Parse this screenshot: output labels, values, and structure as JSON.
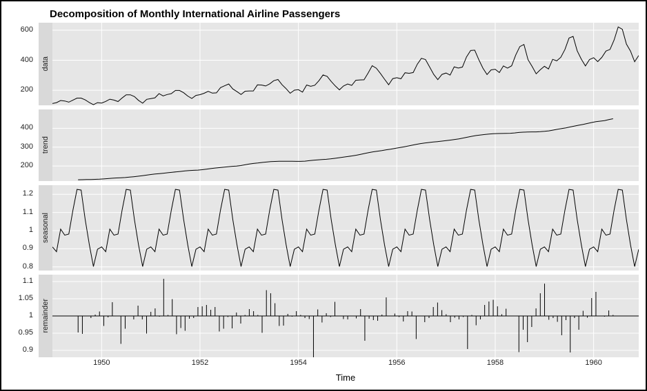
{
  "chart_data": {
    "type": "line",
    "title": "Decomposition of Monthly International Airline Passengers",
    "xlabel": "Time",
    "x_range": [
      1949,
      1960.917
    ],
    "x_ticks": [
      1950,
      1952,
      1954,
      1956,
      1958,
      1960
    ],
    "panels": [
      {
        "name": "data",
        "ylim": [
          100,
          650
        ],
        "yticks": [
          200,
          400,
          600
        ],
        "values": [
          112,
          118,
          132,
          129,
          121,
          135,
          148,
          148,
          136,
          119,
          104,
          118,
          115,
          126,
          141,
          135,
          125,
          149,
          170,
          170,
          158,
          133,
          114,
          140,
          145,
          150,
          178,
          163,
          172,
          178,
          199,
          199,
          184,
          162,
          146,
          166,
          171,
          180,
          193,
          181,
          183,
          218,
          230,
          242,
          209,
          191,
          172,
          194,
          196,
          196,
          236,
          235,
          229,
          243,
          264,
          272,
          237,
          211,
          180,
          201,
          204,
          188,
          235,
          227,
          234,
          264,
          302,
          293,
          259,
          229,
          203,
          229,
          242,
          233,
          267,
          269,
          270,
          315,
          364,
          347,
          312,
          274,
          237,
          278,
          284,
          277,
          317,
          313,
          318,
          374,
          413,
          405,
          355,
          306,
          271,
          306,
          315,
          301,
          356,
          348,
          355,
          422,
          465,
          467,
          404,
          347,
          305,
          336,
          340,
          318,
          362,
          348,
          363,
          435,
          491,
          505,
          404,
          359,
          310,
          337,
          360,
          342,
          406,
          396,
          420,
          472,
          548,
          559,
          463,
          407,
          362,
          405,
          417,
          391,
          419,
          461,
          472,
          535,
          622,
          606,
          508,
          461,
          390,
          432
        ]
      },
      {
        "name": "trend",
        "ylim": [
          120,
          500
        ],
        "yticks": [
          200,
          300,
          400
        ],
        "values": [
          null,
          null,
          null,
          null,
          null,
          null,
          126.79,
          127.25,
          127.96,
          128.58,
          129.0,
          129.75,
          131.25,
          133.08,
          134.92,
          136.42,
          137.42,
          138.75,
          140.92,
          143.17,
          145.71,
          148.42,
          151.54,
          154.71,
          157.13,
          159.54,
          161.83,
          164.13,
          166.67,
          169.08,
          171.25,
          173.58,
          175.46,
          176.83,
          178.04,
          180.17,
          183.13,
          186.21,
          189.04,
          191.29,
          193.58,
          195.83,
          198.04,
          199.75,
          202.21,
          206.25,
          210.42,
          213.38,
          215.83,
          218.5,
          220.92,
          222.92,
          224.08,
          224.71,
          225.33,
          225.33,
          224.96,
          224.58,
          224.46,
          225.54,
          228.0,
          230.46,
          232.25,
          233.92,
          235.63,
          237.75,
          240.5,
          243.96,
          247.17,
          250.25,
          253.5,
          257.13,
          261.83,
          266.67,
          271.13,
          275.21,
          278.5,
          281.96,
          285.75,
          289.33,
          293.25,
          297.17,
          301.0,
          305.46,
          309.96,
          314.42,
          318.63,
          321.75,
          324.5,
          327.08,
          329.54,
          331.83,
          334.46,
          337.54,
          340.54,
          344.08,
          348.25,
          353.0,
          357.63,
          361.38,
          364.5,
          367.17,
          369.46,
          371.21,
          372.17,
          372.42,
          372.75,
          373.63,
          375.25,
          377.92,
          379.5,
          380.0,
          380.71,
          380.96,
          381.83,
          383.67,
          386.5,
          390.33,
          394.71,
          398.63,
          402.54,
          407.17,
          411.88,
          416.33,
          420.5,
          425.5,
          430.71,
          435.13,
          437.71,
          440.96,
          445.83,
          450.62,
          null,
          null,
          null,
          null,
          null,
          null
        ]
      },
      {
        "name": "seasonal",
        "ylim": [
          0.78,
          1.25
        ],
        "yticks": [
          0.8,
          0.9,
          1.0,
          1.1,
          1.2
        ],
        "pattern": [
          0.91,
          0.884,
          1.008,
          0.975,
          0.981,
          1.113,
          1.227,
          1.223,
          1.061,
          0.922,
          0.802,
          0.897
        ],
        "repeats": 12
      },
      {
        "name": "remainder",
        "ylim": [
          0.88,
          1.12
        ],
        "yticks": [
          0.9,
          0.95,
          1.0,
          1.05,
          1.1
        ],
        "values": [
          null,
          null,
          null,
          null,
          null,
          null,
          0.952,
          0.948,
          0.999,
          0.994,
          1.004,
          1.013,
          0.971,
          0.996,
          1.04,
          0.999,
          0.919,
          0.963,
          1.001,
          0.99,
          1.03,
          0.99,
          0.949,
          1.012,
          1.022,
          0.998,
          1.108,
          1.003,
          1.049,
          0.947,
          0.965,
          0.957,
          0.992,
          0.994,
          1.026,
          1.028,
          1.032,
          1.018,
          1.026,
          0.955,
          0.963,
          0.997,
          0.964,
          1.01,
          0.978,
          1.003,
          1.02,
          1.014,
          1.003,
          0.951,
          1.075,
          1.066,
          1.037,
          0.971,
          0.972,
          1.006,
          0.998,
          1.014,
          1.003,
          0.994,
          0.991,
          0.867,
          1.019,
          0.981,
          1.008,
          0.997,
          1.041,
          1.001,
          0.991,
          0.99,
          1.0,
          0.993,
          1.02,
          0.928,
          0.992,
          0.988,
          0.986,
          1.004,
          1.054,
          1.001,
          1.007,
          0.997,
          0.984,
          1.014,
          1.013,
          0.933,
          1.001,
          0.982,
          0.994,
          1.026,
          1.039,
          1.017,
          1.005,
          0.982,
          0.995,
          0.99,
          0.997,
          0.904,
          1.003,
          0.973,
          0.99,
          1.032,
          1.042,
          1.047,
          1.028,
          1.005,
          1.021,
          0.999,
          1.001,
          0.895,
          0.96,
          0.924,
          0.968,
          1.022,
          1.066,
          1.094,
          0.989,
          0.994,
          0.983,
          0.944,
          0.988,
          0.894,
          0.994,
          0.96,
          1.015,
          0.995,
          1.052,
          1.07,
          0.999,
          0.998,
          1.016,
          1.003,
          null,
          null,
          null,
          null,
          null,
          null
        ]
      }
    ]
  }
}
